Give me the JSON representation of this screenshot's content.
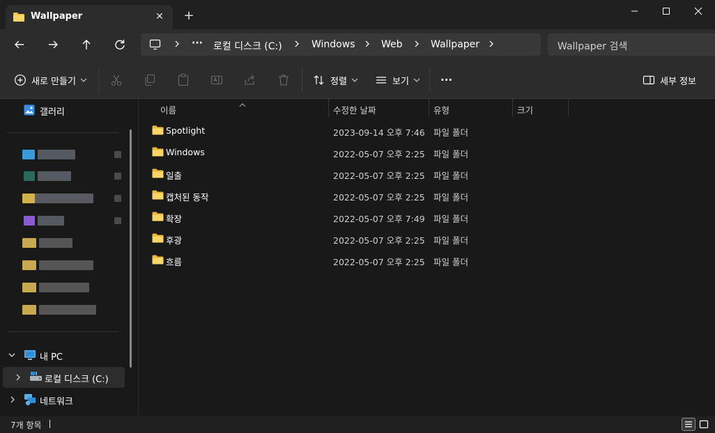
{
  "window": {
    "tab_title": "Wallpaper",
    "new_tab_label": "+",
    "close_tab_label": "✕"
  },
  "address": {
    "breadcrumbs": [
      "로컬 디스크 (C:)",
      "Windows",
      "Web",
      "Wallpaper"
    ],
    "more_label": "···",
    "search_placeholder": "Wallpaper 검색"
  },
  "toolbar": {
    "new_label": "새로 만들기",
    "sort_label": "정렬",
    "view_label": "보기",
    "more_label": "···",
    "details_label": "세부 정보"
  },
  "sidebar": {
    "gallery_label": "갤러리",
    "this_pc_label": "내 PC",
    "local_disk_label": "로컬 디스크 (C:)",
    "network_label": "네트워크"
  },
  "columns": {
    "name": "이름",
    "date": "수정한 날짜",
    "type": "유형",
    "size": "크기"
  },
  "files": [
    {
      "name": "Spotlight",
      "date": "2023-09-14 오후 7:46",
      "type": "파일 폴더"
    },
    {
      "name": "Windows",
      "date": "2022-05-07 오후 2:25",
      "type": "파일 폴더"
    },
    {
      "name": "일출",
      "date": "2022-05-07 오후 2:25",
      "type": "파일 폴더"
    },
    {
      "name": "캡처된 동작",
      "date": "2022-05-07 오후 2:25",
      "type": "파일 폴더"
    },
    {
      "name": "확장",
      "date": "2022-05-07 오후 7:49",
      "type": "파일 폴더"
    },
    {
      "name": "후광",
      "date": "2022-05-07 오후 2:25",
      "type": "파일 폴더"
    },
    {
      "name": "흐름",
      "date": "2022-05-07 오후 2:25",
      "type": "파일 폴더"
    }
  ],
  "status": {
    "item_count": "7개 항목"
  },
  "colors": {
    "folder": "#f2c94c",
    "background": "#191919",
    "chrome": "#2c2c2c"
  }
}
